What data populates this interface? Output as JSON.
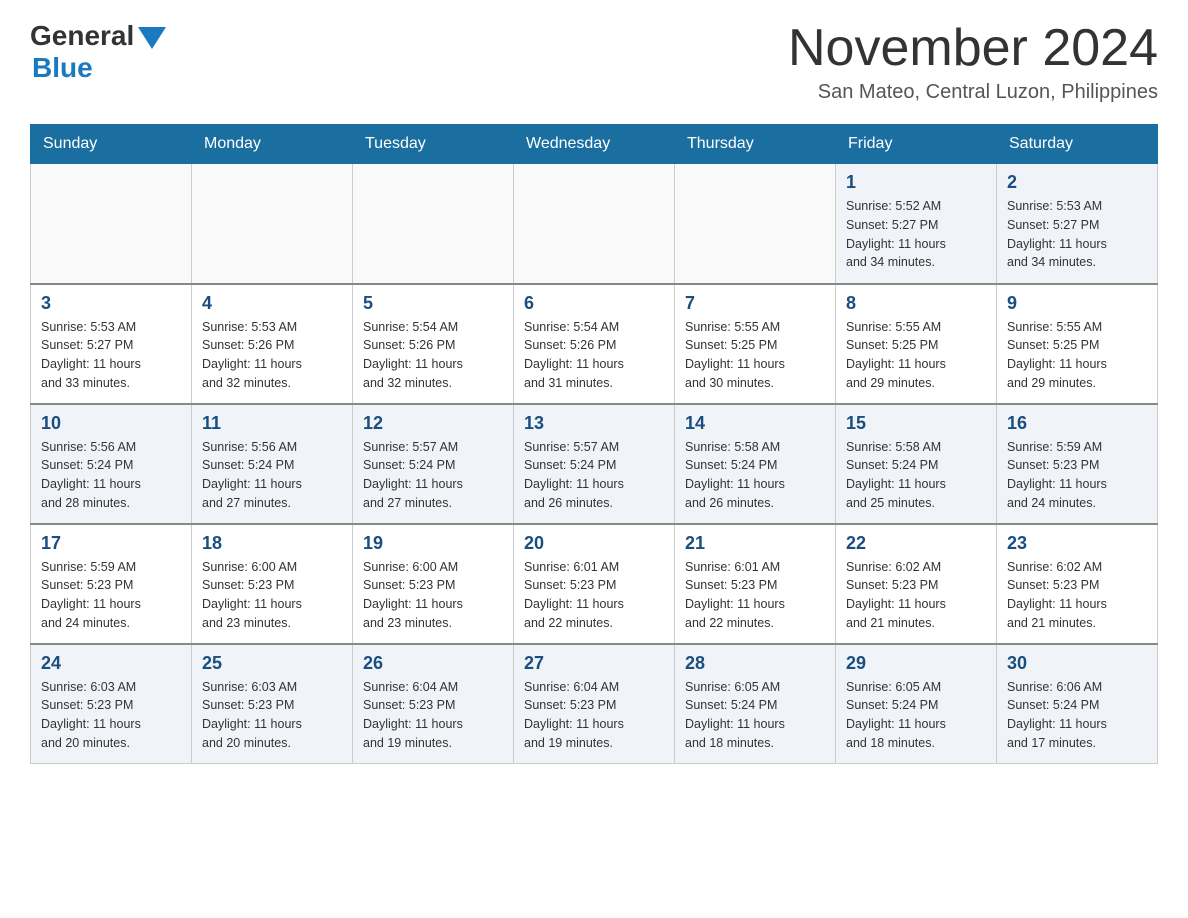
{
  "header": {
    "logo_general": "General",
    "logo_blue": "Blue",
    "month_title": "November 2024",
    "location": "San Mateo, Central Luzon, Philippines"
  },
  "days_of_week": [
    "Sunday",
    "Monday",
    "Tuesday",
    "Wednesday",
    "Thursday",
    "Friday",
    "Saturday"
  ],
  "weeks": [
    [
      {
        "day": "",
        "info": ""
      },
      {
        "day": "",
        "info": ""
      },
      {
        "day": "",
        "info": ""
      },
      {
        "day": "",
        "info": ""
      },
      {
        "day": "",
        "info": ""
      },
      {
        "day": "1",
        "info": "Sunrise: 5:52 AM\nSunset: 5:27 PM\nDaylight: 11 hours\nand 34 minutes."
      },
      {
        "day": "2",
        "info": "Sunrise: 5:53 AM\nSunset: 5:27 PM\nDaylight: 11 hours\nand 34 minutes."
      }
    ],
    [
      {
        "day": "3",
        "info": "Sunrise: 5:53 AM\nSunset: 5:27 PM\nDaylight: 11 hours\nand 33 minutes."
      },
      {
        "day": "4",
        "info": "Sunrise: 5:53 AM\nSunset: 5:26 PM\nDaylight: 11 hours\nand 32 minutes."
      },
      {
        "day": "5",
        "info": "Sunrise: 5:54 AM\nSunset: 5:26 PM\nDaylight: 11 hours\nand 32 minutes."
      },
      {
        "day": "6",
        "info": "Sunrise: 5:54 AM\nSunset: 5:26 PM\nDaylight: 11 hours\nand 31 minutes."
      },
      {
        "day": "7",
        "info": "Sunrise: 5:55 AM\nSunset: 5:25 PM\nDaylight: 11 hours\nand 30 minutes."
      },
      {
        "day": "8",
        "info": "Sunrise: 5:55 AM\nSunset: 5:25 PM\nDaylight: 11 hours\nand 29 minutes."
      },
      {
        "day": "9",
        "info": "Sunrise: 5:55 AM\nSunset: 5:25 PM\nDaylight: 11 hours\nand 29 minutes."
      }
    ],
    [
      {
        "day": "10",
        "info": "Sunrise: 5:56 AM\nSunset: 5:24 PM\nDaylight: 11 hours\nand 28 minutes."
      },
      {
        "day": "11",
        "info": "Sunrise: 5:56 AM\nSunset: 5:24 PM\nDaylight: 11 hours\nand 27 minutes."
      },
      {
        "day": "12",
        "info": "Sunrise: 5:57 AM\nSunset: 5:24 PM\nDaylight: 11 hours\nand 27 minutes."
      },
      {
        "day": "13",
        "info": "Sunrise: 5:57 AM\nSunset: 5:24 PM\nDaylight: 11 hours\nand 26 minutes."
      },
      {
        "day": "14",
        "info": "Sunrise: 5:58 AM\nSunset: 5:24 PM\nDaylight: 11 hours\nand 26 minutes."
      },
      {
        "day": "15",
        "info": "Sunrise: 5:58 AM\nSunset: 5:24 PM\nDaylight: 11 hours\nand 25 minutes."
      },
      {
        "day": "16",
        "info": "Sunrise: 5:59 AM\nSunset: 5:23 PM\nDaylight: 11 hours\nand 24 minutes."
      }
    ],
    [
      {
        "day": "17",
        "info": "Sunrise: 5:59 AM\nSunset: 5:23 PM\nDaylight: 11 hours\nand 24 minutes."
      },
      {
        "day": "18",
        "info": "Sunrise: 6:00 AM\nSunset: 5:23 PM\nDaylight: 11 hours\nand 23 minutes."
      },
      {
        "day": "19",
        "info": "Sunrise: 6:00 AM\nSunset: 5:23 PM\nDaylight: 11 hours\nand 23 minutes."
      },
      {
        "day": "20",
        "info": "Sunrise: 6:01 AM\nSunset: 5:23 PM\nDaylight: 11 hours\nand 22 minutes."
      },
      {
        "day": "21",
        "info": "Sunrise: 6:01 AM\nSunset: 5:23 PM\nDaylight: 11 hours\nand 22 minutes."
      },
      {
        "day": "22",
        "info": "Sunrise: 6:02 AM\nSunset: 5:23 PM\nDaylight: 11 hours\nand 21 minutes."
      },
      {
        "day": "23",
        "info": "Sunrise: 6:02 AM\nSunset: 5:23 PM\nDaylight: 11 hours\nand 21 minutes."
      }
    ],
    [
      {
        "day": "24",
        "info": "Sunrise: 6:03 AM\nSunset: 5:23 PM\nDaylight: 11 hours\nand 20 minutes."
      },
      {
        "day": "25",
        "info": "Sunrise: 6:03 AM\nSunset: 5:23 PM\nDaylight: 11 hours\nand 20 minutes."
      },
      {
        "day": "26",
        "info": "Sunrise: 6:04 AM\nSunset: 5:23 PM\nDaylight: 11 hours\nand 19 minutes."
      },
      {
        "day": "27",
        "info": "Sunrise: 6:04 AM\nSunset: 5:23 PM\nDaylight: 11 hours\nand 19 minutes."
      },
      {
        "day": "28",
        "info": "Sunrise: 6:05 AM\nSunset: 5:24 PM\nDaylight: 11 hours\nand 18 minutes."
      },
      {
        "day": "29",
        "info": "Sunrise: 6:05 AM\nSunset: 5:24 PM\nDaylight: 11 hours\nand 18 minutes."
      },
      {
        "day": "30",
        "info": "Sunrise: 6:06 AM\nSunset: 5:24 PM\nDaylight: 11 hours\nand 17 minutes."
      }
    ]
  ]
}
